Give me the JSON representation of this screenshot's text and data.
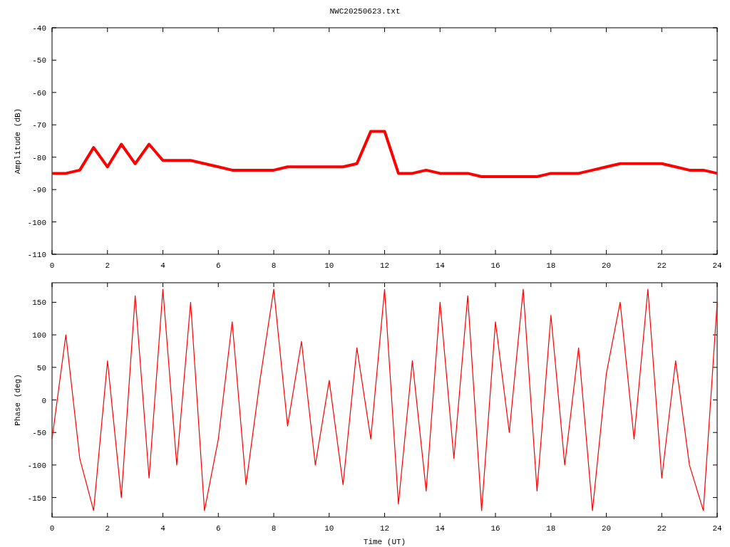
{
  "title": "NWC20250623.txt",
  "charts": [
    {
      "chart_data": {
        "type": "line",
        "ylabel": "Amplitude (dB)",
        "xlim": [
          0,
          24
        ],
        "ylim": [
          -110,
          -40
        ],
        "xticks": [
          0,
          2,
          4,
          6,
          8,
          10,
          12,
          14,
          16,
          18,
          20,
          22,
          24
        ],
        "yticks": [
          -110,
          -100,
          -90,
          -80,
          -70,
          -60,
          -50,
          -40
        ],
        "x": [
          0,
          0.5,
          1,
          1.5,
          2,
          2.5,
          3,
          3.5,
          4,
          4.5,
          5,
          5.5,
          6,
          6.5,
          7,
          7.5,
          8,
          8.5,
          9,
          9.5,
          10,
          10.5,
          11,
          11.5,
          12,
          12.5,
          13,
          13.5,
          14,
          14.5,
          15,
          15.5,
          16,
          16.5,
          17,
          17.5,
          18,
          18.5,
          19,
          19.5,
          20,
          20.5,
          21,
          21.5,
          22,
          22.5,
          23,
          23.5,
          24
        ],
        "series": [
          {
            "color": "#ff0000",
            "values": [
              -85,
              -85,
              -84,
              -77,
              -83,
              -76,
              -82,
              -76,
              -81,
              -81,
              -81,
              -82,
              -83,
              -84,
              -84,
              -84,
              -84,
              -83,
              -83,
              -83,
              -83,
              -83,
              -82,
              -72,
              -72,
              -85,
              -85,
              -84,
              -85,
              -85,
              -85,
              -86,
              -86,
              -86,
              -86,
              -86,
              -85,
              -85,
              -85,
              -84,
              -83,
              -82,
              -82,
              -82,
              -82,
              -83,
              -84,
              -84,
              -85
            ]
          }
        ]
      }
    },
    {
      "chart_data": {
        "type": "line",
        "xlabel": "Time (UT)",
        "ylabel": "Phase (deg)",
        "xlim": [
          0,
          24
        ],
        "ylim": [
          -180,
          180
        ],
        "xticks": [
          0,
          2,
          4,
          6,
          8,
          10,
          12,
          14,
          16,
          18,
          20,
          22,
          24
        ],
        "yticks": [
          -150,
          -100,
          -50,
          0,
          50,
          100,
          150
        ],
        "x": [
          0,
          0.5,
          1,
          1.5,
          2,
          2.5,
          3,
          3.5,
          4,
          4.5,
          5,
          5.5,
          6,
          6.5,
          7,
          7.5,
          8,
          8.5,
          9,
          9.5,
          10,
          10.5,
          11,
          11.5,
          12,
          12.5,
          13,
          13.5,
          14,
          14.5,
          15,
          15.5,
          16,
          16.5,
          17,
          17.5,
          18,
          18.5,
          19,
          19.5,
          20,
          20.5,
          21,
          21.5,
          22,
          22.5,
          23,
          23.5,
          24
        ],
        "series": [
          {
            "color": "#ff0000",
            "values": [
              -60,
              100,
              -90,
              -170,
              60,
              -150,
              160,
              -120,
              170,
              -100,
              150,
              -170,
              -60,
              120,
              -130,
              30,
              170,
              -40,
              90,
              -100,
              30,
              -130,
              80,
              -60,
              170,
              -160,
              60,
              -140,
              150,
              -90,
              160,
              -170,
              120,
              -50,
              170,
              -140,
              130,
              -100,
              80,
              -170,
              40,
              150,
              -60,
              170,
              -120,
              60,
              -100,
              -170,
              150
            ]
          }
        ]
      }
    }
  ]
}
